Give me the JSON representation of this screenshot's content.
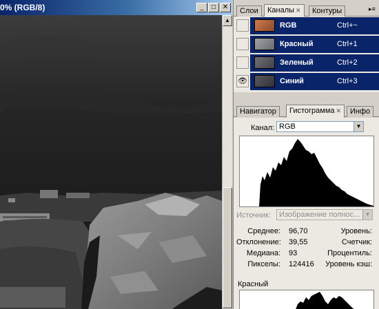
{
  "document": {
    "title": "0% (RGB/8)",
    "buttons": {
      "minimize": "_",
      "maximize": "□",
      "close": "✕"
    }
  },
  "layers_palette": {
    "tabs": [
      {
        "label": "Слои",
        "active": false
      },
      {
        "label": "Каналы",
        "active": true
      },
      {
        "label": "Контуры",
        "active": false
      }
    ],
    "menu_icon": "palette-menu-icon",
    "channels": [
      {
        "name": "RGB",
        "shortcut": "Ctrl+~",
        "visible": false,
        "thumb": "#c06a3e"
      },
      {
        "name": "Красный",
        "shortcut": "Ctrl+1",
        "visible": false,
        "thumb": "#8a8a92"
      },
      {
        "name": "Зеленый",
        "shortcut": "Ctrl+2",
        "visible": false,
        "thumb": "#5a5a60"
      },
      {
        "name": "Синий",
        "shortcut": "Ctrl+3",
        "visible": true,
        "thumb": "#4a4a50"
      }
    ]
  },
  "info_palette": {
    "tabs": [
      {
        "label": "Навигатор",
        "active": false
      },
      {
        "label": "Гистограмма",
        "active": true
      },
      {
        "label": "Инфо",
        "active": false
      }
    ],
    "channel_label": "Канал:",
    "channel_value": "RGB",
    "source_label": "Источник:",
    "source_value": "Изображение полнос...",
    "stats_left": [
      {
        "label": "Среднее:",
        "value": "96,70"
      },
      {
        "label": "Отклонение:",
        "value": "39,55"
      },
      {
        "label": "Медиана:",
        "value": "93"
      },
      {
        "label": "Пикселы:",
        "value": "124416"
      }
    ],
    "stats_right": [
      "Уровень:",
      "Счетчик:",
      "Процентиль:",
      "Уровень кэш:"
    ],
    "sub_channel": "Красный"
  }
}
